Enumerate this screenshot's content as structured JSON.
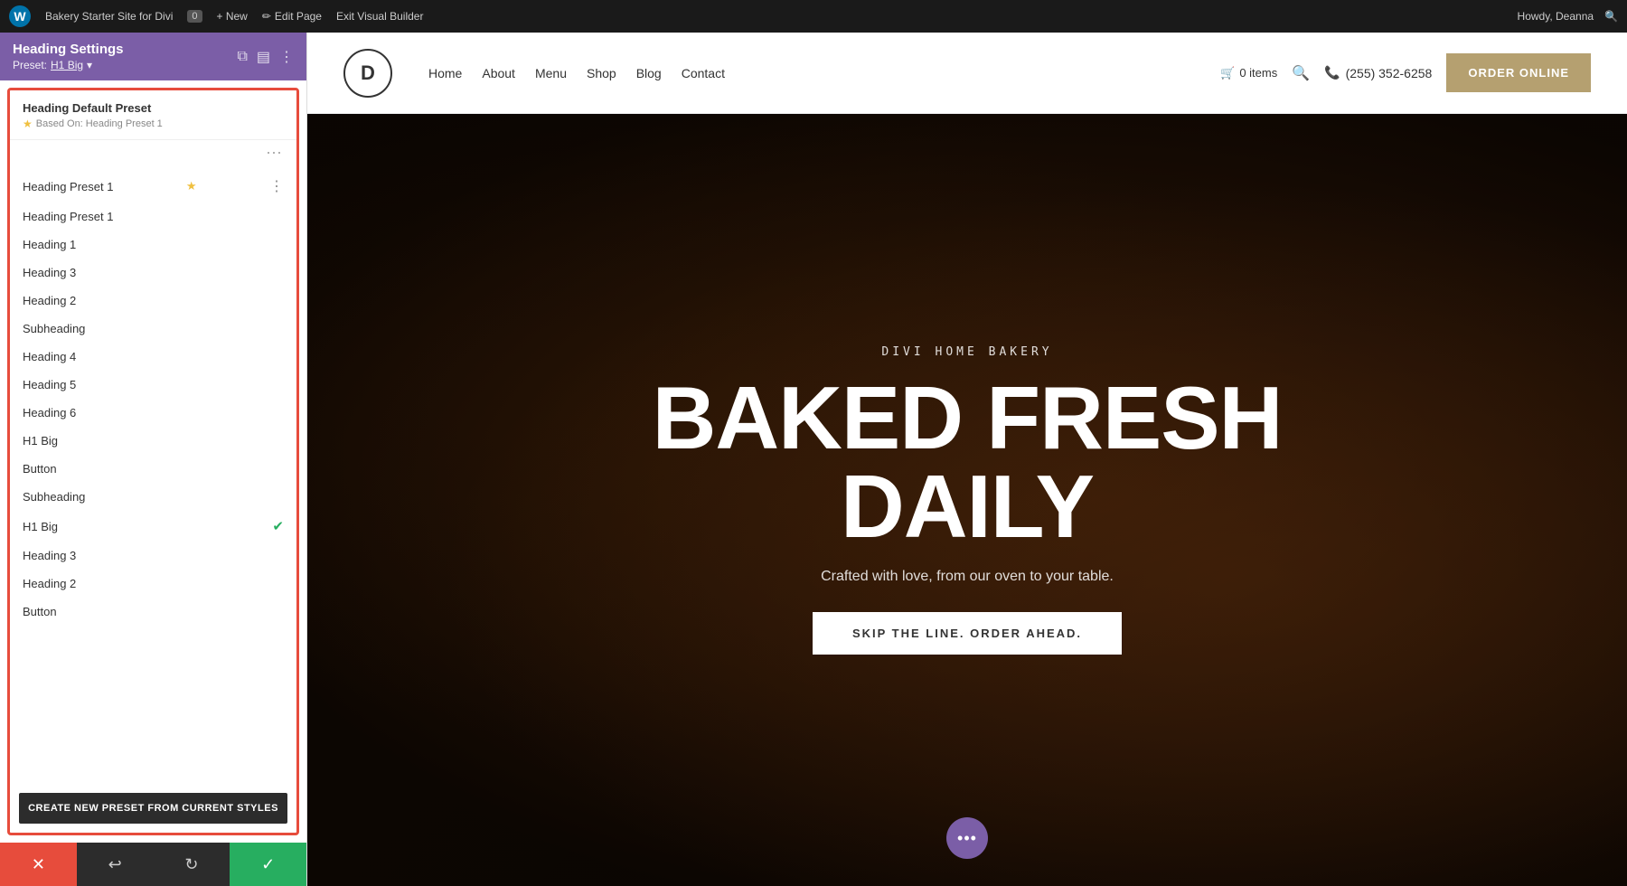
{
  "adminBar": {
    "logo": "W",
    "siteLabel": "Bakery Starter Site for Divi",
    "commentCount": "0",
    "newLabel": "+ New",
    "editPageLabel": "Edit Page",
    "exitVBLabel": "Exit Visual Builder",
    "howdyLabel": "Howdy, Deanna",
    "searchIcon": "🔍"
  },
  "panel": {
    "title": "Heading Settings",
    "preset_label": "Preset:",
    "preset_name": "H1 Big",
    "preset_dropdown_icon": "▾",
    "icons": [
      "⧉",
      "▤",
      "⋮"
    ]
  },
  "defaultPreset": {
    "title": "Heading Default Preset",
    "basedOn": "Based On: Heading Preset 1"
  },
  "presetItems": [
    {
      "label": "Heading Preset 1",
      "star": true,
      "dots": true
    },
    {
      "label": "Heading Preset 1",
      "star": false,
      "dots": false
    },
    {
      "label": "Heading 1",
      "star": false,
      "dots": false
    },
    {
      "label": "Heading 3",
      "star": false,
      "dots": false
    },
    {
      "label": "Heading 2",
      "star": false,
      "dots": false
    },
    {
      "label": "Subheading",
      "star": false,
      "dots": false
    },
    {
      "label": "Heading 4",
      "star": false,
      "dots": false
    },
    {
      "label": "Heading 5",
      "star": false,
      "dots": false
    },
    {
      "label": "Heading 6",
      "star": false,
      "dots": false
    },
    {
      "label": "H1 Big",
      "star": false,
      "dots": false
    },
    {
      "label": "Button",
      "star": false,
      "dots": false
    },
    {
      "label": "Subheading",
      "star": false,
      "dots": false
    },
    {
      "label": "H1 Big",
      "check": true,
      "dots": false
    },
    {
      "label": "Heading 3",
      "star": false,
      "dots": false
    },
    {
      "label": "Heading 2",
      "star": false,
      "dots": false
    },
    {
      "label": "Button",
      "star": false,
      "dots": false
    }
  ],
  "createPresetBtn": "CREATE NEW PRESET FROM CURRENT STYLES",
  "bottomToolbar": {
    "cancel": "✕",
    "undo": "↩",
    "redo": "↻",
    "save": "✓"
  },
  "siteNav": {
    "logo": "D",
    "links": [
      "Home",
      "About",
      "Menu",
      "Shop",
      "Blog",
      "Contact"
    ],
    "cartLabel": "0 items",
    "phone": "(255) 352-6258",
    "orderBtn": "ORDER ONLINE"
  },
  "hero": {
    "subtitle": "DIVI HOME BAKERY",
    "title": "BAKED FRESH\nDAILY",
    "tagline": "Crafted with love, from our oven to your table.",
    "ctaLabel": "SKIP THE LINE. ORDER AHEAD.",
    "floatingDots": "•••"
  }
}
